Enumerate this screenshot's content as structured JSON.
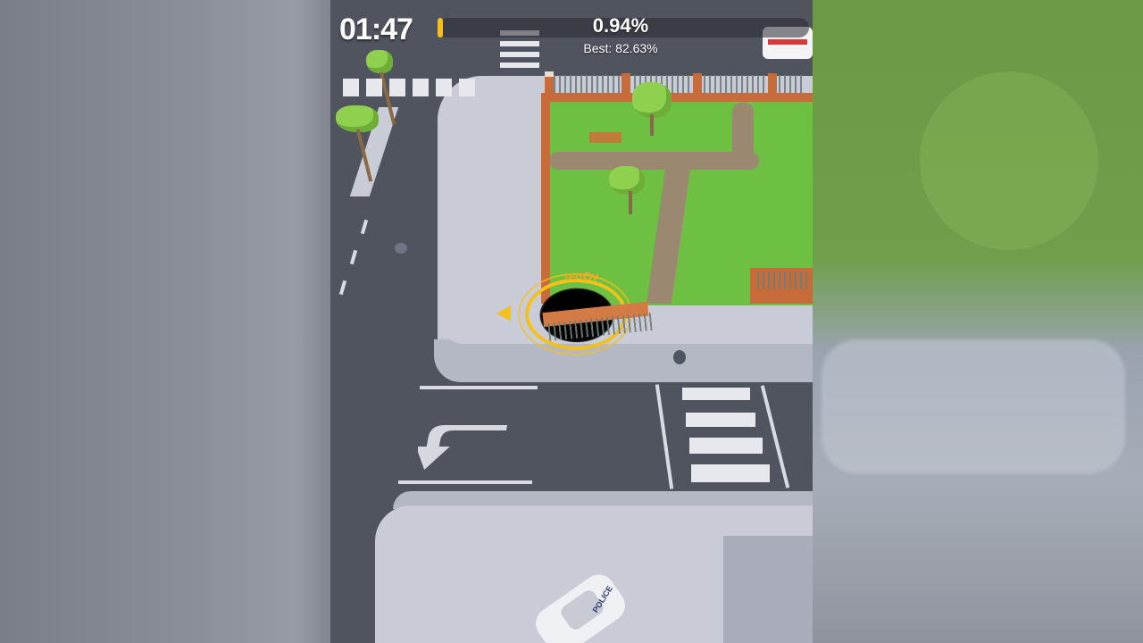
{
  "hud": {
    "timer": "01:47",
    "progress_percent": "0.94%",
    "progress_value": 0.94,
    "best_label": "Best: 82.63%"
  },
  "player": {
    "name": "tertOv"
  },
  "vehicles": {
    "police_label": "POLICE"
  },
  "colors": {
    "accent": "#f4c11b",
    "grass": "#6ec043",
    "road": "#50545f",
    "sidewalk": "#c9cbd6",
    "brick": "#c86b3a"
  }
}
